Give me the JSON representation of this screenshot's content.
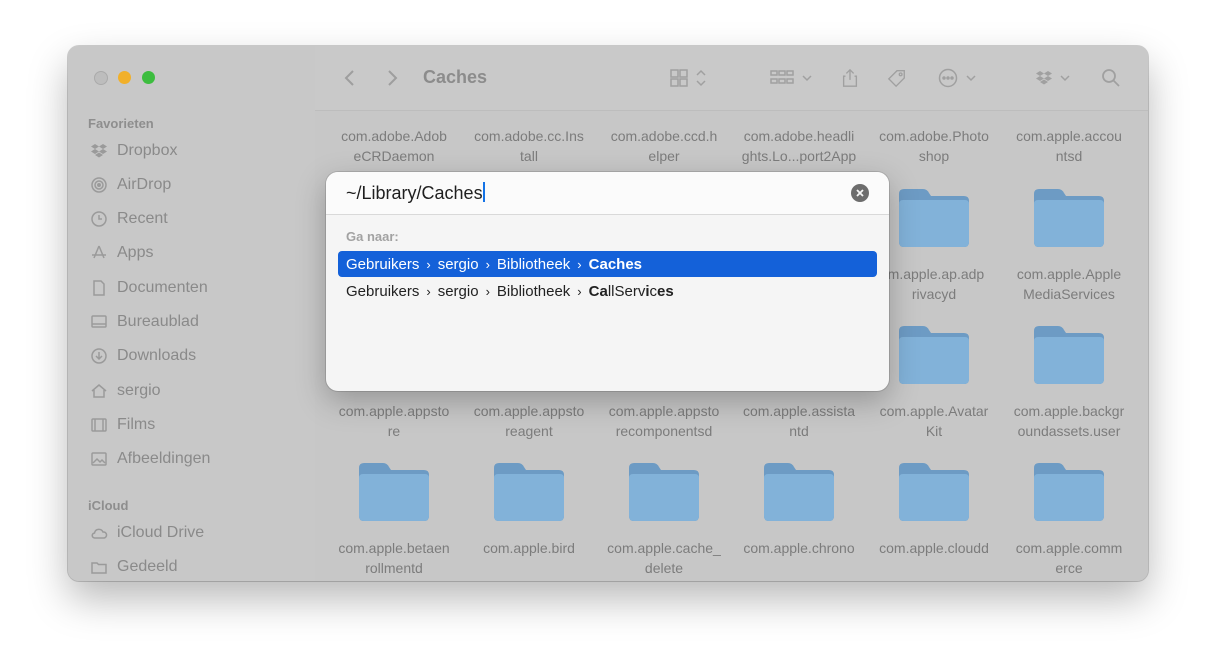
{
  "window": {
    "title": "Caches"
  },
  "sidebar": {
    "favorites_header": "Favorieten",
    "favorites": [
      {
        "label": "Dropbox",
        "icon": "dropbox-icon"
      },
      {
        "label": "AirDrop",
        "icon": "airdrop-icon"
      },
      {
        "label": "Recent",
        "icon": "clock-icon"
      },
      {
        "label": "Apps",
        "icon": "apps-icon"
      },
      {
        "label": "Documenten",
        "icon": "document-icon"
      },
      {
        "label": "Bureaublad",
        "icon": "desktop-icon"
      },
      {
        "label": "Downloads",
        "icon": "download-icon"
      },
      {
        "label": "sergio",
        "icon": "home-icon"
      },
      {
        "label": "Films",
        "icon": "film-icon"
      },
      {
        "label": "Afbeeldingen",
        "icon": "photo-icon"
      }
    ],
    "icloud_header": "iCloud",
    "icloud": [
      {
        "label": "iCloud Drive",
        "icon": "cloud-icon"
      },
      {
        "label": "Gedeeld",
        "icon": "shared-folder-icon"
      }
    ]
  },
  "files": {
    "row1": [
      "com.adobe.Adob\neCRDaemon",
      "com.adobe.cc.Ins\ntall",
      "com.adobe.ccd.h\nelper",
      "com.adobe.headli\nghts.Lo...port2App",
      "com.adobe.Photo\nshop",
      "com.apple.accou\nntsd"
    ],
    "row2_visible": [
      ".m.apple.ap.adp\nrivacyd",
      "com.apple.Apple\nMediaServices"
    ],
    "row3": [
      "com.apple.appsto\nre",
      "com.apple.appsto\nreagent",
      "com.apple.appsto\nrecomponentsd",
      "com.apple.assista\nntd",
      "com.apple.Avatar\nKit",
      "com.apple.backgr\noundassets.user"
    ],
    "row4": [
      "com.apple.betaen\nrollmentd",
      "com.apple.bird",
      "com.apple.cache_\ndelete",
      "com.apple.chrono",
      "com.apple.cloudd",
      "com.apple.comm\nerce"
    ]
  },
  "goto": {
    "input_value": "~/Library/Caches",
    "section_label": "Ga naar:",
    "suggestions": [
      {
        "parts": [
          "Gebruikers",
          "sergio",
          "Bibliotheek"
        ],
        "last": "Caches",
        "selected": true
      },
      {
        "parts": [
          "Gebruikers",
          "sergio",
          "Bibliotheek"
        ],
        "last_bold": "Ca",
        "last_rest": "llServ",
        "last_bold2": "i",
        "last_rest2": "c",
        "last_bold3": "es",
        "selected": false
      }
    ]
  },
  "colors": {
    "accent": "#1461d9",
    "folder": "#7fb0d8",
    "traffic_min": "#f1b02a",
    "traffic_max": "#3dbd3f"
  }
}
